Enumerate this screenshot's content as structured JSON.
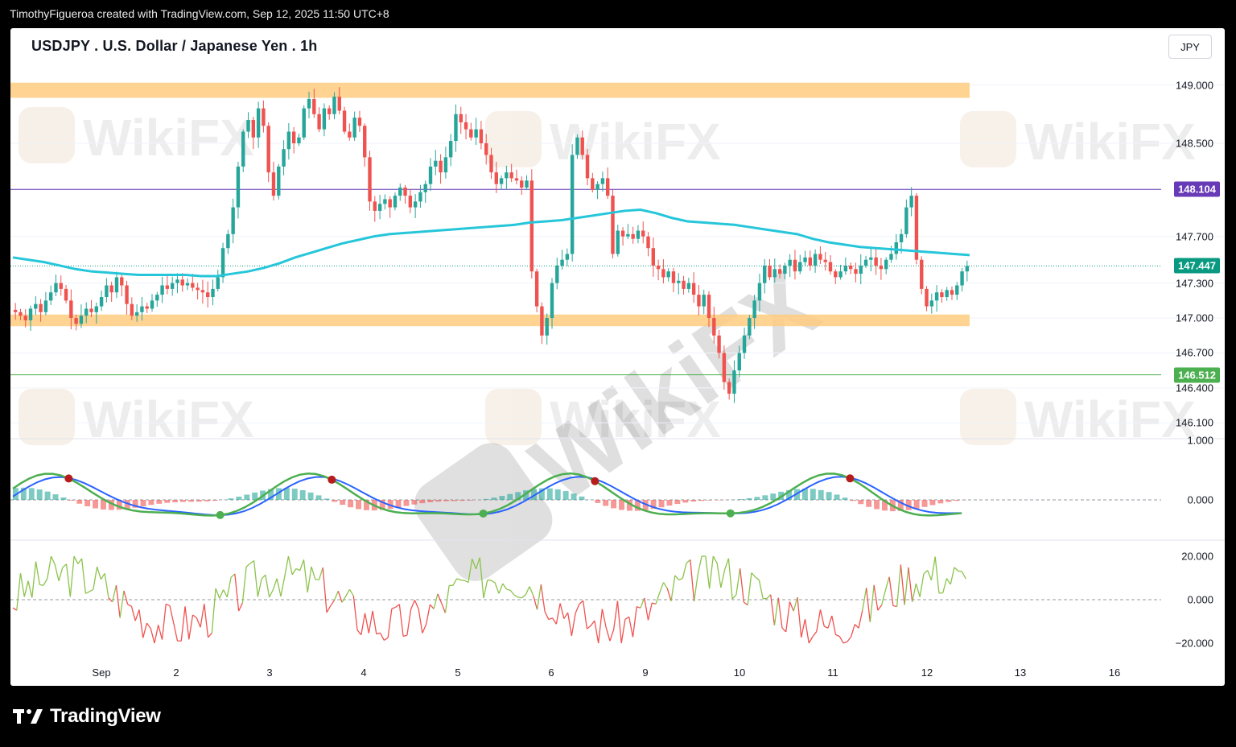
{
  "header": {
    "text": "TimothyFigueroa created with TradingView.com, Sep 12, 2025 11:50 UTC+8"
  },
  "chart_title": "USDJPY . U.S. Dollar / Japanese Yen . 1h",
  "currency_button": "JPY",
  "footer": {
    "logo_text": "TradingView"
  },
  "watermark_text": "WikiFX",
  "colors": {
    "bull": "#26a69a",
    "bear": "#ef5350",
    "ma": "#26c6da",
    "zone": "#ffcc80",
    "resistance_line": "#673ab7",
    "support_line": "#4caf50",
    "last_price": "#089981",
    "macd_fast": "#4caf50",
    "macd_slow": "#2962ff",
    "signal_line": "#b71c1c",
    "osc_up": "#8bc34a",
    "osc_down": "#ef5350"
  },
  "chart_data": {
    "type": "candlestick",
    "symbol": "USDJPY",
    "interval": "1h",
    "x_labels": [
      "Sep",
      "2",
      "3",
      "4",
      "5",
      "6",
      "9",
      "10",
      "11",
      "12",
      "13",
      "16"
    ],
    "price_axis": {
      "ticks": [
        "149.000",
        "148.500",
        "147.700",
        "147.300",
        "147.000",
        "146.700",
        "146.400",
        "146.100"
      ],
      "range": [
        145.95,
        149.35
      ]
    },
    "price_tags": [
      {
        "label": "148.104",
        "value": 148.104,
        "color": "#673ab7"
      },
      {
        "label": "147.447",
        "value": 147.447,
        "color": "#089981"
      },
      {
        "label": "146.512",
        "value": 146.512,
        "color": "#4caf50"
      }
    ],
    "zones": [
      {
        "low": 148.89,
        "high": 149.02
      },
      {
        "low": 146.93,
        "high": 147.03
      }
    ],
    "close_series": [
      147.05,
      147.02,
      146.98,
      147.08,
      147.12,
      147.05,
      147.15,
      147.22,
      147.3,
      147.25,
      147.15,
      147.0,
      146.95,
      147.02,
      147.08,
      147.05,
      147.1,
      147.18,
      147.28,
      147.22,
      147.35,
      147.28,
      147.12,
      147.02,
      147.05,
      147.1,
      147.08,
      147.15,
      147.2,
      147.28,
      147.25,
      147.3,
      147.33,
      147.28,
      147.3,
      147.26,
      147.24,
      147.22,
      147.18,
      147.25,
      147.35,
      147.6,
      147.72,
      147.95,
      148.3,
      148.6,
      148.7,
      148.55,
      148.8,
      148.65,
      148.25,
      148.05,
      148.3,
      148.45,
      148.6,
      148.5,
      148.55,
      148.8,
      148.88,
      148.75,
      148.62,
      148.8,
      148.75,
      148.9,
      148.78,
      148.6,
      148.55,
      148.72,
      148.65,
      148.38,
      148.0,
      147.92,
      147.98,
      148.02,
      147.95,
      148.05,
      148.12,
      148.05,
      147.95,
      148.0,
      148.08,
      148.15,
      148.3,
      148.35,
      148.25,
      148.38,
      148.52,
      148.75,
      148.68,
      148.62,
      148.55,
      148.62,
      148.5,
      148.4,
      148.25,
      148.15,
      148.2,
      148.25,
      148.2,
      148.18,
      148.12,
      148.18,
      147.4,
      147.1,
      146.85,
      147.0,
      147.3,
      147.45,
      147.5,
      147.55,
      148.4,
      148.55,
      148.4,
      148.2,
      148.1,
      148.15,
      148.2,
      148.05,
      147.55,
      147.75,
      147.7,
      147.72,
      147.68,
      147.75,
      147.7,
      147.6,
      147.45,
      147.42,
      147.35,
      147.4,
      147.3,
      147.32,
      147.25,
      147.3,
      147.2,
      147.1,
      147.2,
      147.0,
      146.85,
      146.7,
      146.45,
      146.35,
      146.55,
      146.7,
      146.85,
      147.0,
      147.15,
      147.3,
      147.45,
      147.35,
      147.42,
      147.38,
      147.45,
      147.5,
      147.4,
      147.48,
      147.52,
      147.45,
      147.55,
      147.5,
      147.48,
      147.4,
      147.35,
      147.4,
      147.45,
      147.42,
      147.38,
      147.45,
      147.5,
      147.52,
      147.45,
      147.42,
      147.5,
      147.55,
      147.65,
      147.72,
      147.95,
      148.05,
      147.5,
      147.25,
      147.1,
      147.15,
      147.22,
      147.18,
      147.24,
      147.2,
      147.28,
      147.4,
      147.447
    ],
    "series": [
      {
        "name": "MA",
        "type": "line",
        "values": [
          147.52,
          147.5,
          147.48,
          147.45,
          147.42,
          147.4,
          147.39,
          147.38,
          147.37,
          147.37,
          147.37,
          147.37,
          147.36,
          147.36,
          147.38,
          147.4,
          147.43,
          147.47,
          147.52,
          147.56,
          147.6,
          147.64,
          147.67,
          147.7,
          147.72,
          147.73,
          147.74,
          147.75,
          147.76,
          147.77,
          147.78,
          147.79,
          147.8,
          147.82,
          147.83,
          147.84,
          147.86,
          147.88,
          147.9,
          147.92,
          147.93,
          147.9,
          147.86,
          147.83,
          147.82,
          147.81,
          147.8,
          147.78,
          147.76,
          147.74,
          147.72,
          147.68,
          147.65,
          147.63,
          147.61,
          147.6,
          147.59,
          147.58,
          147.57,
          147.56,
          147.55,
          147.54
        ]
      },
      {
        "name": "MACD fast",
        "type": "line",
        "panel": "oscillator"
      },
      {
        "name": "MACD slow",
        "type": "line",
        "panel": "oscillator"
      },
      {
        "name": "Histogram",
        "type": "bar",
        "panel": "oscillator"
      },
      {
        "name": "Momentum",
        "type": "line",
        "panel": "momentum"
      }
    ],
    "osc_panel": {
      "ticks": [
        "1.000",
        "0.000"
      ]
    },
    "momentum_panel": {
      "ticks": [
        "20.000",
        "0.000",
        "−20.000"
      ]
    }
  }
}
